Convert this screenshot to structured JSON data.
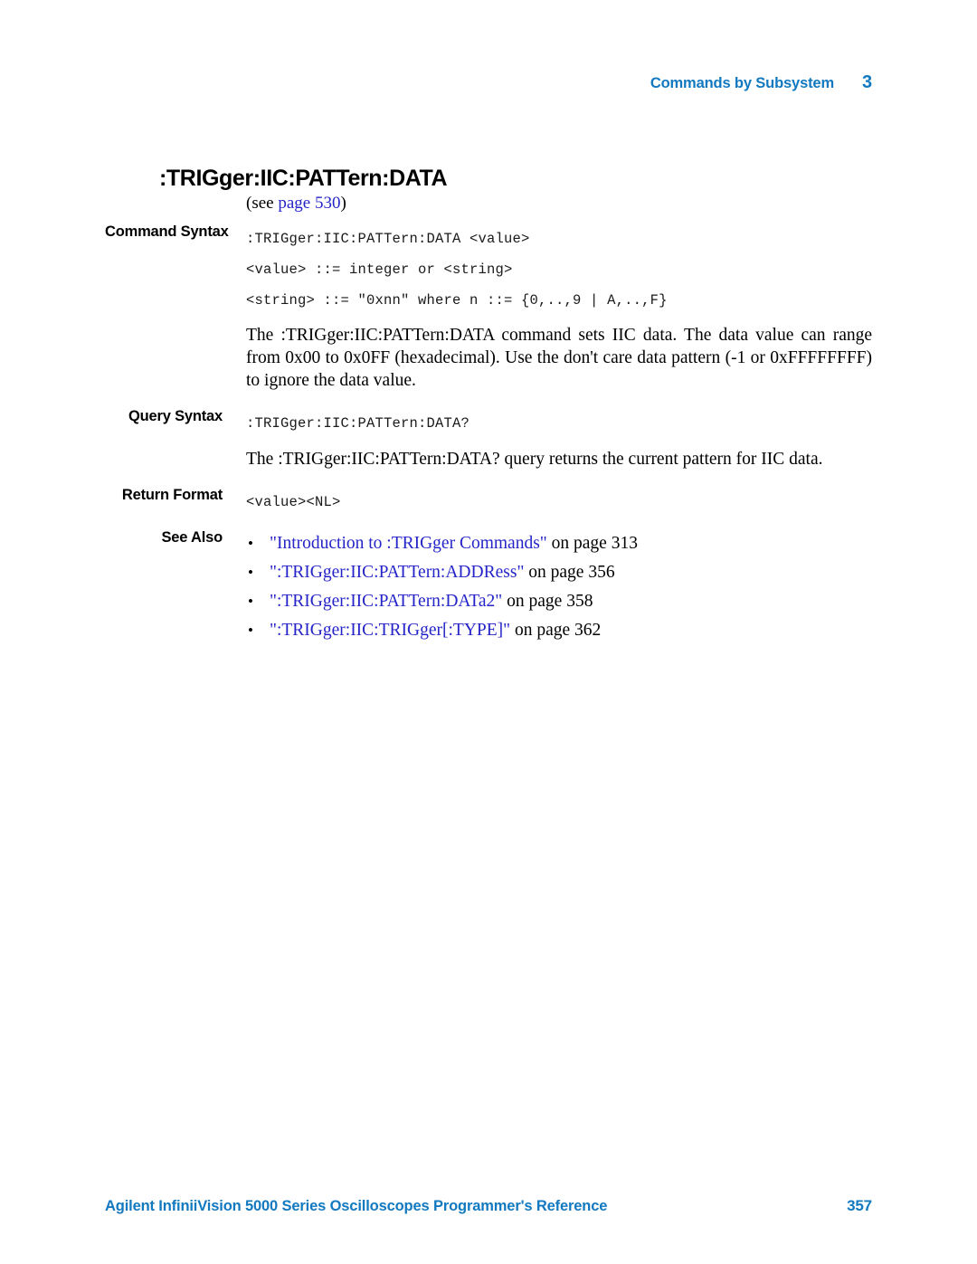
{
  "header": {
    "chapter_title": "Commands by Subsystem",
    "chapter_number": "3"
  },
  "command": {
    "title": ":TRIGger:IIC:PATTern:DATA",
    "see_reference": {
      "prefix": "(see ",
      "link_text": "page  530",
      "suffix": ")"
    }
  },
  "sections": {
    "command_syntax": {
      "label": "Command Syntax",
      "code_lines": [
        ":TRIGger:IIC:PATTern:DATA <value>",
        "<value> ::= integer or <string>",
        "<string> ::= \"0xnn\" where n ::= {0,..,9 | A,..,F}"
      ],
      "description": "The :TRIGger:IIC:PATTern:DATA command sets IIC data. The data value can range from 0x00 to 0x0FF (hexadecimal). Use the don't care data pattern (-1 or 0xFFFFFFFF) to ignore the data value."
    },
    "query_syntax": {
      "label": "Query Syntax",
      "code_lines": [
        ":TRIGger:IIC:PATTern:DATA?"
      ],
      "description": "The :TRIGger:IIC:PATTern:DATA? query returns the current pattern for IIC data."
    },
    "return_format": {
      "label": "Return Format",
      "code_lines": [
        "<value><NL>"
      ]
    },
    "see_also": {
      "label": "See Also",
      "items": [
        {
          "link": "\"Introduction to :TRIGger Commands\"",
          "tail": " on page  313"
        },
        {
          "link": "\":TRIGger:IIC:PATTern:ADDRess\"",
          "tail": " on page  356"
        },
        {
          "link": "\":TRIGger:IIC:PATTern:DATa2\"",
          "tail": " on page  358"
        },
        {
          "link": "\":TRIGger:IIC:TRIGger[:TYPE]\"",
          "tail": " on page  362"
        }
      ]
    }
  },
  "footer": {
    "document_title": "Agilent InfiniiVision 5000 Series Oscilloscopes Programmer's Reference",
    "page_number": "357"
  },
  "colors": {
    "brand_blue": "#1279c0",
    "link_blue": "#2424c8",
    "text_black": "#000000"
  }
}
